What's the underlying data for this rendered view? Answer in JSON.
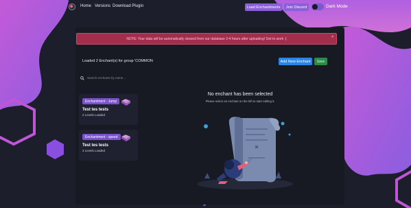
{
  "nav": {
    "home": "Home",
    "versions": "Versions",
    "download": "Download Plugin",
    "load_enchantments": "Load Enchantments",
    "join_discord": "Join Discord",
    "dark_mode": "Dark Mode"
  },
  "alert": {
    "message": "NOTE: Your data will be automatically cleared from our database 2-4 hours after uploading! Get to work :)",
    "close": "×"
  },
  "main": {
    "loaded_text": "Loaded 2 Enchant(s) for group 'COMMON",
    "add_button": "Add New Enchant",
    "save_button": "Save",
    "search_placeholder": "Search enchants by name...",
    "empty_title": "No enchant has been selected",
    "empty_subtitle": "Please select an enchant on the left to start editing it."
  },
  "enchants": [
    {
      "tag": "Enchantment - Jump",
      "title": "Test tes tests",
      "levels": "2 Levels Loaded"
    },
    {
      "tag": "Enchantment - speed",
      "title": "Test tes tests",
      "levels": "2 Levels Loaded"
    }
  ],
  "colors": {
    "background": "#1c1e2c",
    "panel": "#171923",
    "accent_purple": "#8b5fd8",
    "alert_red": "#a32d4d",
    "add_blue": "#2a86e6",
    "save_green": "#2f8a4a"
  },
  "icons": [
    "logo-icon",
    "search-icon",
    "book-icon",
    "close-icon"
  ]
}
